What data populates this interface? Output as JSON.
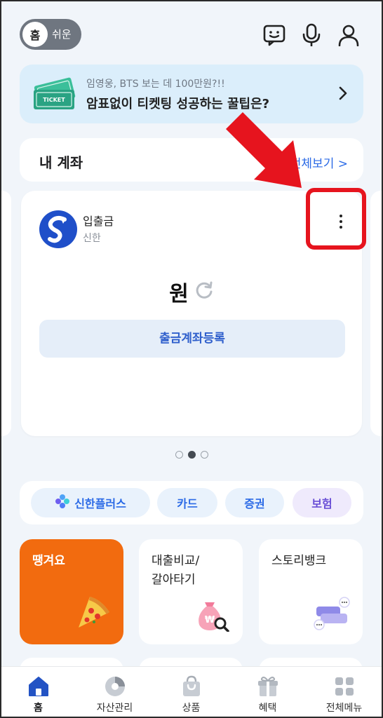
{
  "header": {
    "mode_home": "홈",
    "mode_easy": "쉬운"
  },
  "banner": {
    "subtitle": "임영웅, BTS 보는 데 100만원?!!",
    "title": "암표없이 티켓팅 성공하는 꿀팁은?",
    "ticket_text": "TICKET"
  },
  "accounts": {
    "title": "내 계좌",
    "more_label": "전체보기 >",
    "card": {
      "account_name": "입출금",
      "bank_name": "신한",
      "balance_unit": "원",
      "register_label": "출금계좌등록"
    },
    "pagination": {
      "count": 3,
      "active": 1
    }
  },
  "chips": [
    {
      "label": "신한플러스",
      "color": "#2b6ae6"
    },
    {
      "label": "카드",
      "color": "#2b6ae6"
    },
    {
      "label": "증권",
      "color": "#2b6ae6"
    },
    {
      "label": "보험",
      "color": "#6a4fd6"
    }
  ],
  "tiles": [
    {
      "label": "땡겨요",
      "style": "orange"
    },
    {
      "label": "대출비교/\n갈아타기",
      "style": "white"
    },
    {
      "label": "스토리뱅크",
      "style": "white"
    }
  ],
  "nav": [
    {
      "label": "홈",
      "icon": "home-icon",
      "active": true
    },
    {
      "label": "자산관리",
      "icon": "pie-chart-icon",
      "active": false
    },
    {
      "label": "상품",
      "icon": "shopping-bag-icon",
      "active": false
    },
    {
      "label": "혜택",
      "icon": "gift-icon",
      "active": false
    },
    {
      "label": "전체메뉴",
      "icon": "grid-menu-icon",
      "active": false
    }
  ],
  "colors": {
    "accent_blue": "#2b6ae6",
    "highlight_red": "#e6141e",
    "orange_tile": "#f26b0f",
    "banner_bg": "#dbeefb"
  }
}
